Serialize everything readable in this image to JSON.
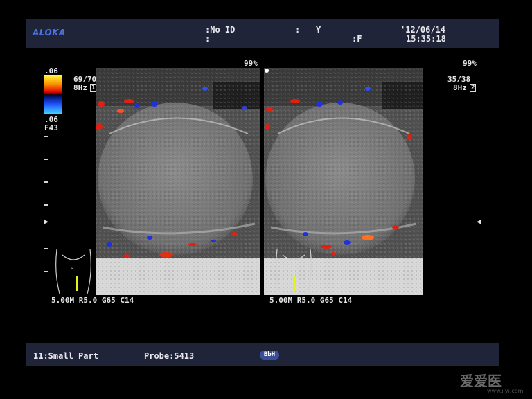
{
  "header": {
    "brand": "ALOKA",
    "patient_id_label": ":No ID",
    "colon": ":",
    "sex_label": ":",
    "sex_value": "Y",
    "age_label": ":F",
    "date": "'12/06/14",
    "time": "15:35:18"
  },
  "left_panel": {
    "gain_top": "99%",
    "color_scale_top": ".06",
    "color_scale_bottom": ".06",
    "filter": "F43",
    "frame_rate": "69/70",
    "frequency": "8Hz",
    "frame_index": "1",
    "params": "5.00M R5.0 G65 C14"
  },
  "right_panel": {
    "gain_top": "99%",
    "frame_rate": "35/38",
    "frequency": "8Hz",
    "frame_index": "2",
    "params": "5.00M R5.0 G65 C14"
  },
  "footer": {
    "preset": "11:Small Part",
    "probe": "Probe:5413",
    "mode_badge": "BbH"
  },
  "watermark": {
    "text": "爱爱医",
    "url": "www.iiyi.com"
  },
  "colors": {
    "bar_bg": "#1f2438",
    "brand": "#4a72e6",
    "doppler_red": "#e02010",
    "doppler_blue": "#2030e0"
  }
}
